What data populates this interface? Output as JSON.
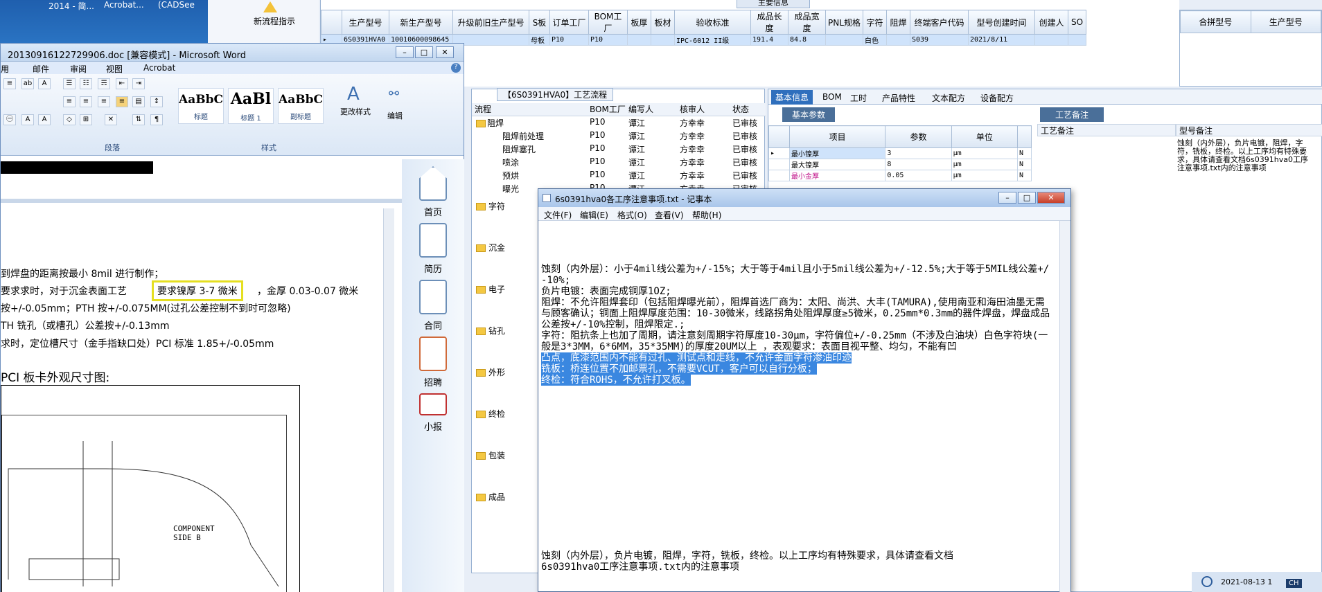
{
  "desktop": {
    "icon_labels": [
      "2014 - 简...",
      "Acrobat...",
      "(CADSee"
    ],
    "flow_label": "新流程指示"
  },
  "erp_table": {
    "group_title": "主要信息",
    "headers": [
      "生产型号",
      "新生产型号",
      "升级前旧生产型号",
      "S板",
      "订单工厂",
      "BOM工厂",
      "板厚",
      "板材",
      "验收标准",
      "成品长度",
      "成品宽度",
      "PNL规格",
      "字符",
      "阻焊",
      "终端客户代码",
      "型号创建时间",
      "创建人",
      "SO"
    ],
    "row": [
      "6S0391HVA0",
      "10010600098645",
      "",
      "母板",
      "P10",
      "P10",
      "",
      "",
      "IPC-6012 II级",
      "191.4",
      "84.8",
      "",
      "白色",
      "",
      "S039",
      "2021/8/11",
      "",
      ""
    ],
    "side_headers": [
      "合拼型号",
      "生产型号"
    ]
  },
  "word": {
    "title": "20130916122729906.doc [兼容模式] - Microsoft Word",
    "menu": [
      "用",
      "邮件",
      "审阅",
      "视图",
      "Acrobat"
    ],
    "styles": [
      {
        "sample": "AaBbC",
        "name": "标题"
      },
      {
        "sample": "AaBl",
        "name": "标题 1"
      },
      {
        "sample": "AaBbC",
        "name": "副标题"
      }
    ],
    "change_style": "更改样式",
    "edit": "编辑",
    "group_paragraph": "段落",
    "group_style": "样式",
    "lines": [
      "到焊盘的距离按最小 8mil 进行制作；",
      "要求求时，对于沉金表面工艺",
      "要求镍厚 3-7 微米",
      "，金厚 0.03-0.07 微米",
      "按+/-0.05mm；PTH 按+/-0.075MM(过孔公差控制不到时可忽略)",
      "TH 铣孔（或槽孔）公差按+/-0.13mm",
      "求时，定位槽尺寸（金手指缺口处）PCI 标准 1.85+/-0.05mm",
      "PCI 板卡外观尺寸图:"
    ],
    "drawing_label": "COMPONENT SIDE B"
  },
  "sidebar": {
    "items": [
      "首页",
      "简历",
      "合同",
      "招聘",
      "小报"
    ]
  },
  "process": {
    "title": "【6S0391HVA0】工艺流程",
    "headers": [
      "流程",
      "BOM工厂",
      "编写人",
      "核审人",
      "状态"
    ],
    "rows": [
      {
        "name": "阻焊",
        "bom": "P10",
        "writer": "谭江",
        "reviewer": "方幸幸",
        "status": "已审核"
      },
      {
        "name": "阻焊前处理",
        "bom": "P10",
        "writer": "谭江",
        "reviewer": "方幸幸",
        "status": "已审核"
      },
      {
        "name": "阻焊塞孔",
        "bom": "P10",
        "writer": "谭江",
        "reviewer": "方幸幸",
        "status": "已审核"
      },
      {
        "name": "喷涂",
        "bom": "P10",
        "writer": "谭江",
        "reviewer": "方幸幸",
        "status": "已审核"
      },
      {
        "name": "预烘",
        "bom": "P10",
        "writer": "谭江",
        "reviewer": "方幸幸",
        "status": "已审核"
      },
      {
        "name": "曝光",
        "bom": "P10",
        "writer": "谭江",
        "reviewer": "方幸幸",
        "status": "已审核"
      }
    ],
    "folders": [
      "字符",
      "沉金",
      "电子",
      "钻孔",
      "外形",
      "终检",
      "包装",
      "成品"
    ]
  },
  "info": {
    "tabs": [
      "基本信息",
      "BOM",
      "工时",
      "产品特性",
      "文本配方",
      "设备配方"
    ],
    "subtab": "基本参数",
    "headers": [
      "项目",
      "参数",
      "单位"
    ],
    "rows": [
      {
        "item": "最小镍厚",
        "value": "3",
        "unit": "μm",
        "flag": "N"
      },
      {
        "item": "最大镍厚",
        "value": "8",
        "unit": "μm",
        "flag": "N"
      },
      {
        "item": "最小金厚",
        "value": "0.05",
        "unit": "μm",
        "flag": "N"
      }
    ],
    "craft_tab": "工艺备注",
    "craft_col": "工艺备注",
    "model_col": "型号备注",
    "model_note": "蚀刻（内外层），负片电镀，阻焊，字符，铣板，终检。以上工序均有特殊要求，具体请查看文档6s0391hva0工序注意事项.txt内的注意事项"
  },
  "notepad": {
    "title": "6s0391hva0各工序注意事项.txt - 记事本",
    "menu": [
      "文件(F)",
      "编辑(E)",
      "格式(O)",
      "查看(V)",
      "帮助(H)"
    ],
    "text": "蚀刻（内外层）：小于4mil线公差为+/-15%；大于等于4mil且小于5mil线公差为+/-12.5%;大于等于5MIL线公差+/-10%;\n负片电镀：表面完成铜厚1OZ;\n阻焊：不允许阻焊套印（包括阻焊曝光前），阻焊首选厂商为：太阳、尚洪、大丰(TAMURA),使用南亚和海田油墨无需与顾客确认；铜面上阻焊厚度范围：10-30微米，线路拐角处阻焊厚度≥5微米，0.25mm*0.3mm的器件焊盘，焊盘成品公差按+/-10%控制，阻焊限定.;\n字符：阻抗条上也加了周期，请注意刻周期字符厚度10-30μm，字符偏位+/-0.25mm（不涉及白油块）白色字符块(一般是3*3MM，6*6MM，35*35MM)的厚度20UM以上 ，表观要求：表面目视平整、均匀，不能有凹",
    "highlight": "凸点，底漆范围内不能有过孔、测试点和走线，不允许金面字符渗油印迹\n铣板：桥连位置不加邮票孔，不需要VCUT，客户可以自行分板；\n终检：符合ROHS，不允许打叉板。",
    "bottom": "蚀刻（内外层），负片电镀，阻焊，字符，铣板，终检。以上工序均有特殊要求，具体请查看文档\n6s0391hva0工序注意事项.txt内的注意事项"
  },
  "status": {
    "date": "2021-08-13 1",
    "ime": "CH"
  }
}
